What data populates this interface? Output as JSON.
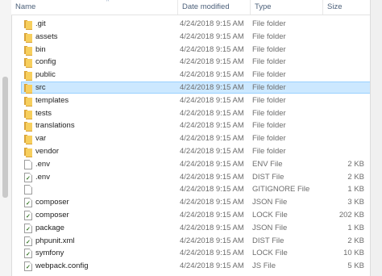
{
  "columns": {
    "name": "Name",
    "date": "Date modified",
    "type": "Type",
    "size": "Size"
  },
  "sort_arrow": "^",
  "rows": [
    {
      "name": ".git",
      "date": "4/24/2018 9:15 AM",
      "type": "File folder",
      "size": "",
      "icon": "folder-icon"
    },
    {
      "name": "assets",
      "date": "4/24/2018 9:15 AM",
      "type": "File folder",
      "size": "",
      "icon": "folder-icon"
    },
    {
      "name": "bin",
      "date": "4/24/2018 9:15 AM",
      "type": "File folder",
      "size": "",
      "icon": "folder-icon"
    },
    {
      "name": "config",
      "date": "4/24/2018 9:15 AM",
      "type": "File folder",
      "size": "",
      "icon": "folder-icon"
    },
    {
      "name": "public",
      "date": "4/24/2018 9:15 AM",
      "type": "File folder",
      "size": "",
      "icon": "folder-icon"
    },
    {
      "name": "src",
      "date": "4/24/2018 9:15 AM",
      "type": "File folder",
      "size": "",
      "icon": "folder-icon",
      "selected": true
    },
    {
      "name": "templates",
      "date": "4/24/2018 9:15 AM",
      "type": "File folder",
      "size": "",
      "icon": "folder-icon"
    },
    {
      "name": "tests",
      "date": "4/24/2018 9:15 AM",
      "type": "File folder",
      "size": "",
      "icon": "folder-icon"
    },
    {
      "name": "translations",
      "date": "4/24/2018 9:15 AM",
      "type": "File folder",
      "size": "",
      "icon": "folder-icon"
    },
    {
      "name": "var",
      "date": "4/24/2018 9:15 AM",
      "type": "File folder",
      "size": "",
      "icon": "folder-icon"
    },
    {
      "name": "vendor",
      "date": "4/24/2018 9:15 AM",
      "type": "File folder",
      "size": "",
      "icon": "folder-icon"
    },
    {
      "name": ".env",
      "date": "4/24/2018 9:15 AM",
      "type": "ENV File",
      "size": "2 KB",
      "icon": "file-icon"
    },
    {
      "name": ".env",
      "date": "4/24/2018 9:15 AM",
      "type": "DIST File",
      "size": "2 KB",
      "icon": "checked-file-icon"
    },
    {
      "name": "",
      "date": "4/24/2018 9:15 AM",
      "type": "GITIGNORE File",
      "size": "1 KB",
      "icon": "file-icon"
    },
    {
      "name": "composer",
      "date": "4/24/2018 9:15 AM",
      "type": "JSON File",
      "size": "3 KB",
      "icon": "checked-file-icon"
    },
    {
      "name": "composer",
      "date": "4/24/2018 9:15 AM",
      "type": "LOCK File",
      "size": "202 KB",
      "icon": "checked-file-icon"
    },
    {
      "name": "package",
      "date": "4/24/2018 9:15 AM",
      "type": "JSON File",
      "size": "1 KB",
      "icon": "checked-file-icon"
    },
    {
      "name": "phpunit.xml",
      "date": "4/24/2018 9:15 AM",
      "type": "DIST File",
      "size": "2 KB",
      "icon": "checked-file-icon"
    },
    {
      "name": "symfony",
      "date": "4/24/2018 9:15 AM",
      "type": "LOCK File",
      "size": "10 KB",
      "icon": "checked-file-icon"
    },
    {
      "name": "webpack.config",
      "date": "4/24/2018 9:15 AM",
      "type": "JS File",
      "size": "5 KB",
      "icon": "checked-file-icon"
    }
  ]
}
